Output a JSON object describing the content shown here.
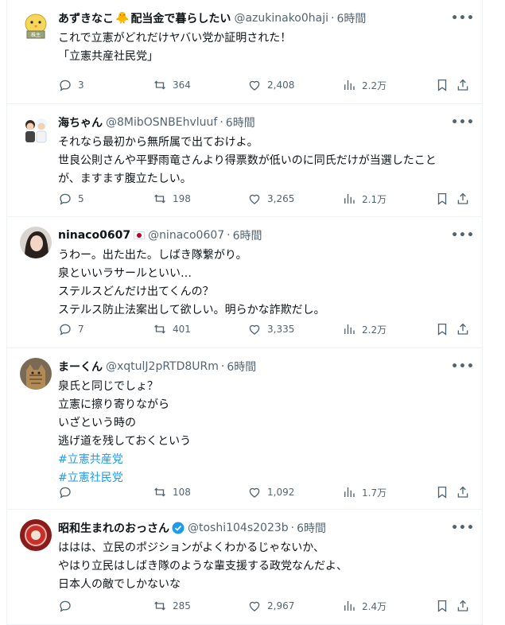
{
  "tweets": [
    {
      "name": "あずきなこ",
      "name_suffix": "配当金で暮らしたい",
      "handle": "@azukinako0haji",
      "time": "6時間",
      "lines": [
        "これで立憲がどれだけヤバい党か証明された！",
        "「立憲共産社民党」"
      ],
      "hashtags": [],
      "replies": "3",
      "retweets": "364",
      "likes": "2,408",
      "views": "2.2万"
    },
    {
      "name": "海ちゃん",
      "handle": "@8MibOSNBEhvluuf",
      "time": "6時間",
      "lines": [
        "それなら最初から無所属で出ておけよ。",
        "世良公則さんや平野雨竜さんより得票数が低いのに同氏だけが当選したこと",
        "が、ますます腹立たしい。"
      ],
      "hashtags": [],
      "replies": "5",
      "retweets": "198",
      "likes": "3,265",
      "views": "2.1万"
    },
    {
      "name": "ninaco0607",
      "handle": "@ninaco0607",
      "time": "6時間",
      "lines": [
        "うわー。出た出た。しばき隊繋がり。",
        "泉といいラサールといい…",
        "ステルスどんだけ出てくんの？",
        "ステルス防止法案出して欲しい。明らかな詐欺だし。"
      ],
      "hashtags": [],
      "replies": "7",
      "retweets": "401",
      "likes": "3,335",
      "views": "2.2万"
    },
    {
      "name": "まーくん",
      "handle": "@xqtulJ2pRTD8URm",
      "time": "6時間",
      "lines": [
        "泉氏と同じでしょ？",
        "立憲に擦り寄りながら",
        "いざという時の",
        "逃げ道を残しておくという"
      ],
      "hashtags": [
        "#立憲共産党",
        "#立憲社民党"
      ],
      "replies": "",
      "retweets": "108",
      "likes": "1,092",
      "views": "1.7万"
    },
    {
      "name": "昭和生まれのおっさん",
      "handle": "@toshi104s2023b",
      "time": "6時間",
      "lines": [
        "ははは、立民のポジションがよくわかるじゃないか、",
        "やはり立民はしばき隊のような輩支援する政党なんだよ、",
        "日本人の敵でしかないな"
      ],
      "hashtags": [],
      "replies": "",
      "retweets": "285",
      "likes": "2,967",
      "views": "2.4万"
    }
  ],
  "colors": {
    "text": "#0f1419",
    "muted": "#536471",
    "link": "#1d9bf0",
    "border": "#eff3f4",
    "verified": "#1d9bf0"
  },
  "icons": {
    "more": "more-icon",
    "reply": "reply-icon",
    "retweet": "retweet-icon",
    "like": "heart-icon",
    "views": "views-icon",
    "bookmark": "bookmark-icon",
    "share": "share-icon"
  }
}
